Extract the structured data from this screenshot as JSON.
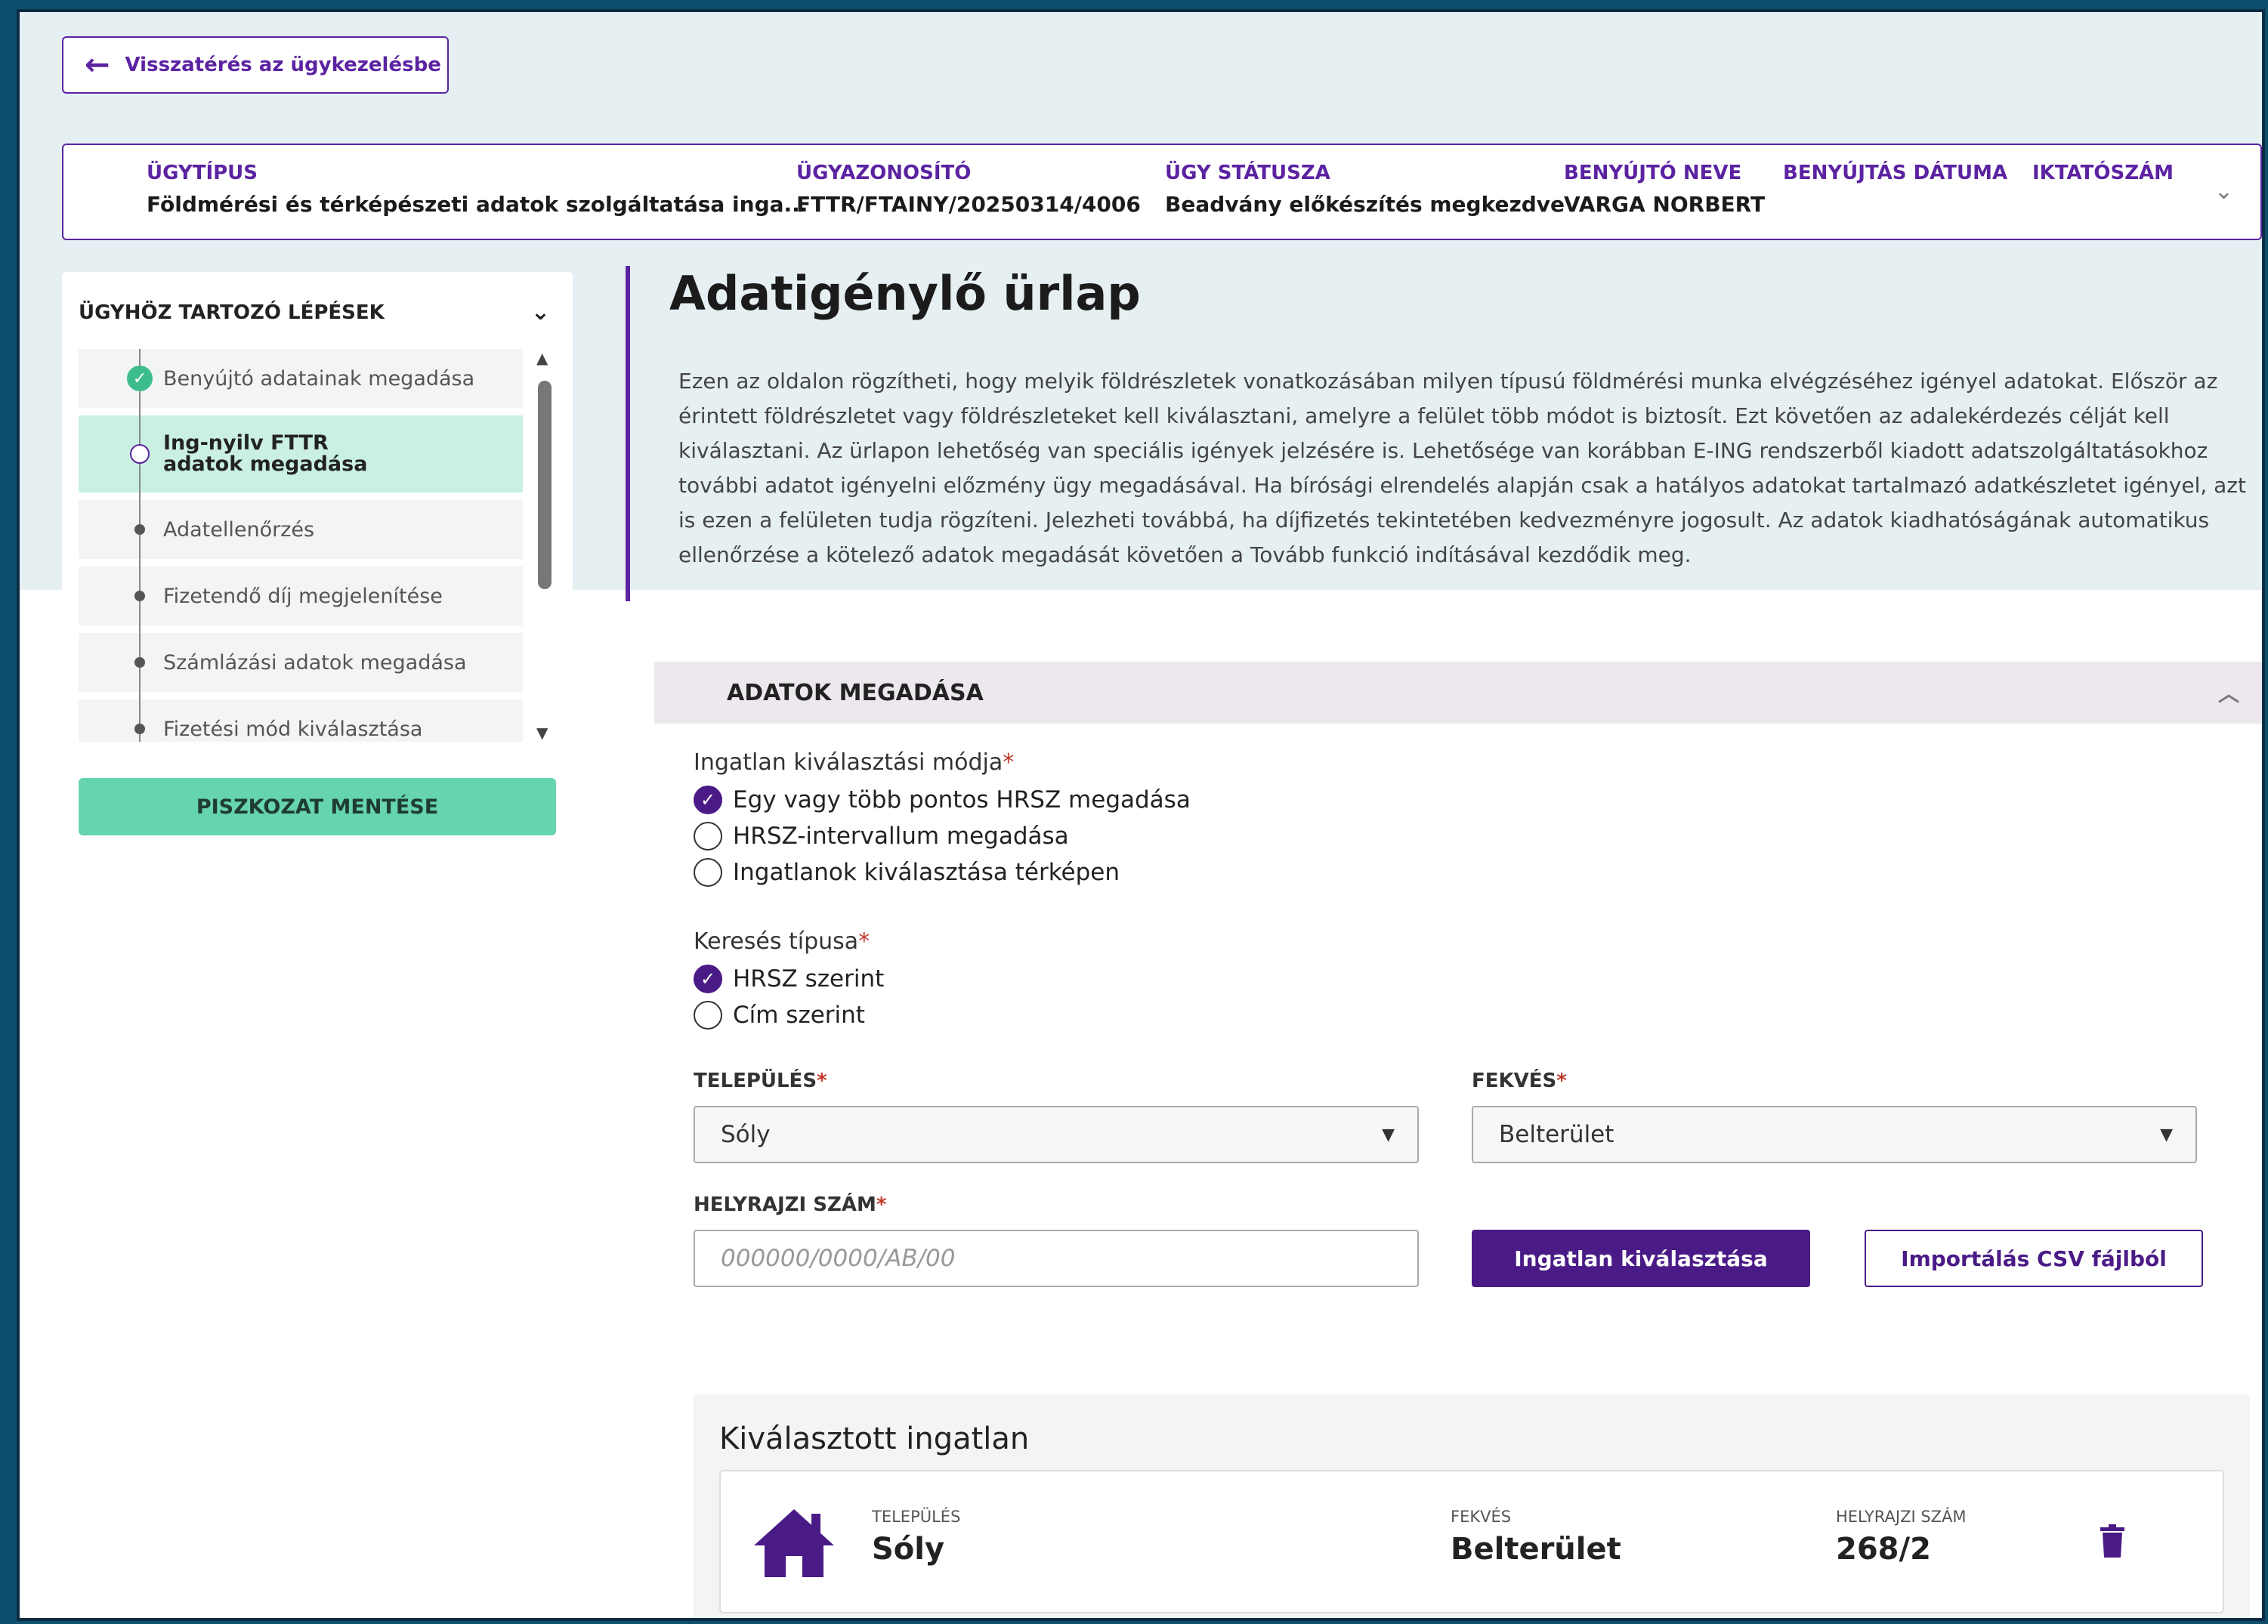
{
  "back": {
    "label": "Visszatérés az ügykezelésbe"
  },
  "case_bar": {
    "fields": [
      {
        "label": "ÜGYTÍPUS",
        "value": "Földmérési és térképészeti adatok szolgáltatása inga..."
      },
      {
        "label": "ÜGYAZONOSÍTÓ",
        "value": "FTTR/FTAINY/20250314/4006"
      },
      {
        "label": "ÜGY STÁTUSZA",
        "value": "Beadvány előkészítés megkezdve"
      },
      {
        "label": "BENYÚJTÓ NEVE",
        "value": "VARGA NORBERT"
      },
      {
        "label": "BENYÚJTÁS DÁTUMA",
        "value": ""
      },
      {
        "label": "IKTATÓSZÁM",
        "value": ""
      }
    ]
  },
  "steps": {
    "title": "ÜGYHÖZ TARTOZÓ LÉPÉSEK",
    "items": [
      {
        "label": "Benyújtó adatainak megadása",
        "state": "done"
      },
      {
        "label": "Ing-nyilv FTTR adatok megadása",
        "state": "current"
      },
      {
        "label": "Adatellenőrzés",
        "state": "todo"
      },
      {
        "label": "Fizetendő díj megjelenítése",
        "state": "todo"
      },
      {
        "label": "Számlázási adatok megadása",
        "state": "todo"
      },
      {
        "label": "Fizetési mód kiválasztása",
        "state": "todo"
      }
    ],
    "save_label": "PISZKOZAT MENTÉSE"
  },
  "page": {
    "title": "Adatigénylő ürlap",
    "intro": "Ezen az oldalon rögzítheti, hogy melyik földrészletek vonatkozásában milyen típusú földmérési munka elvégzéséhez igényel adatokat. Először az érintett földrészletet vagy földrészleteket kell kiválasztani, amelyre a felület több módot is biztosít. Ezt követően az adalekérdezés célját kell kiválasztani. Az ürlapon lehetőség van speciális igények jelzésére is. Lehetősége van korábban E-ING rendszerből kiadott adatszolgáltatásokhoz további adatot igényelni előzmény ügy megadásával. Ha bírósági elrendelés alapján csak a hatályos adatokat tartalmazó adatkészletet igényel, azt is ezen a felületen tudja rögzíteni. Jelezheti továbbá, ha díjfizetés tekintetében kedvezményre jogosult. Az adatok kiadhatóságának automatikus ellenőrzése a kötelező adatok megadását követően a Tovább funkció indításával kezdődik meg."
  },
  "section": {
    "title": "ADATOK MEGADÁSA",
    "selection_mode": {
      "label": "Ingatlan kiválasztási módja",
      "options": [
        {
          "label": "Egy vagy több pontos HRSZ megadása",
          "checked": true
        },
        {
          "label": "HRSZ-intervallum megadása",
          "checked": false
        },
        {
          "label": "Ingatlanok kiválasztása térképen",
          "checked": false
        }
      ]
    },
    "search_type": {
      "label": "Keresés típusa",
      "options": [
        {
          "label": "HRSZ szerint",
          "checked": true
        },
        {
          "label": "Cím szerint",
          "checked": false
        }
      ]
    },
    "settlement": {
      "label": "TELEPÜLÉS",
      "value": "Sóly"
    },
    "location": {
      "label": "FEKVÉS",
      "value": "Belterület"
    },
    "parcel": {
      "label": "HELYRAJZI SZÁM",
      "placeholder": "000000/0000/AB/00",
      "value": ""
    },
    "select_button": "Ingatlan kiválasztása",
    "import_button": "Importálás CSV fájlból",
    "required_mark": "*"
  },
  "selected": {
    "title": "Kiválasztott ingatlan",
    "settlement_label": "TELEPÜLÉS",
    "settlement_value": "Sóly",
    "location_label": "FEKVÉS",
    "location_value": "Belterület",
    "parcel_label": "HELYRAJZI SZÁM",
    "parcel_value": "268/2"
  },
  "colors": {
    "brand_purple": "#4a1b86",
    "accent_green": "#66d4ae",
    "active_step_bg": "#c9f0e1"
  }
}
